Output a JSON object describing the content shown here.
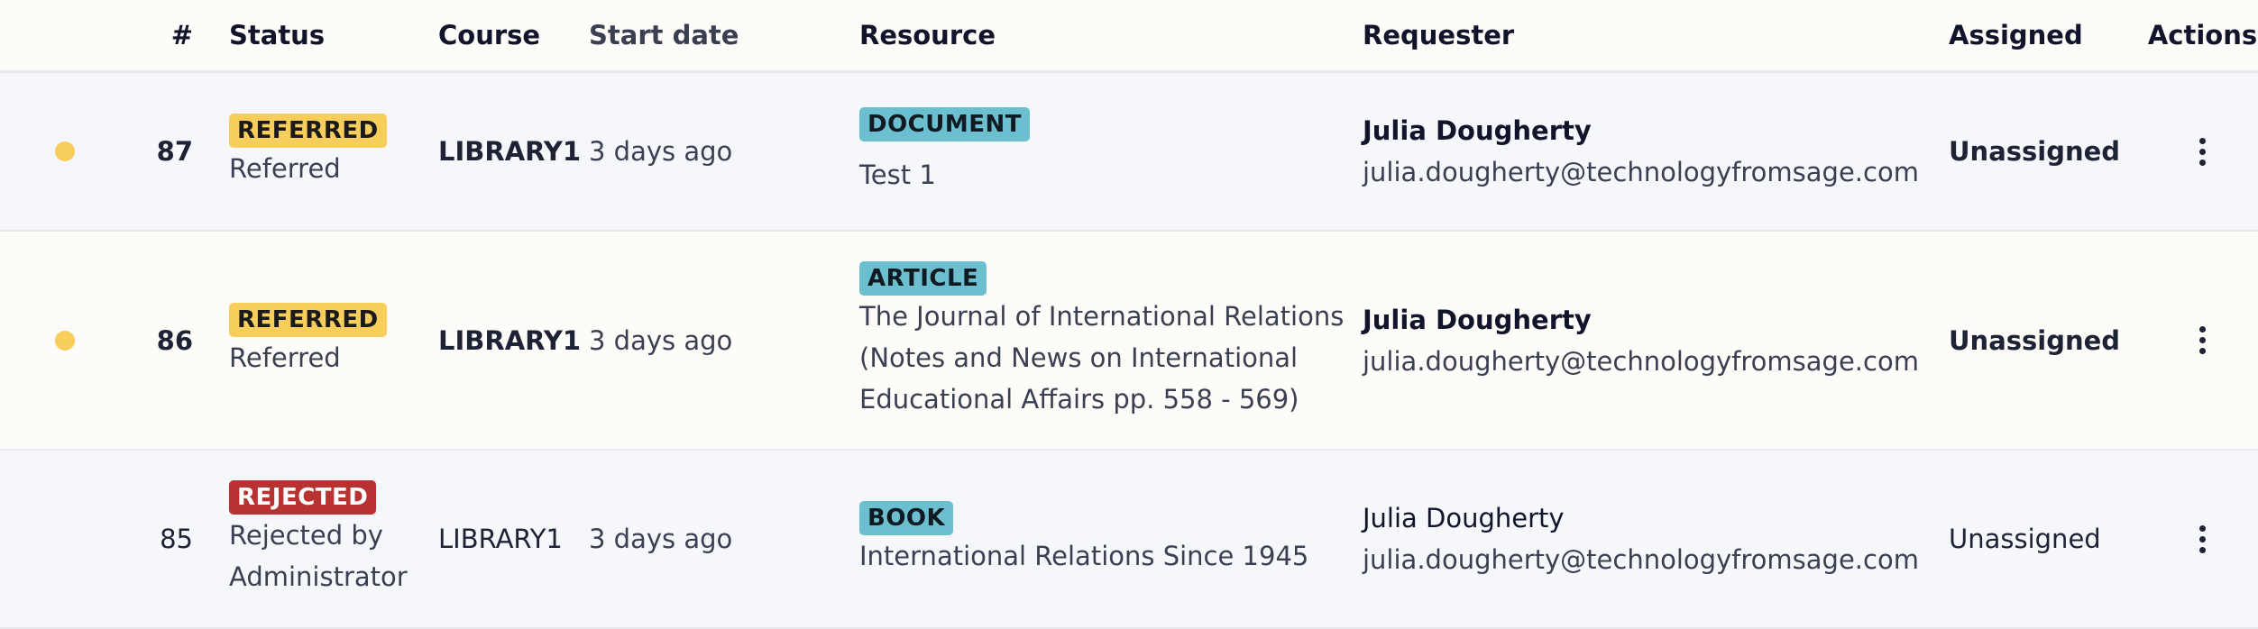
{
  "header": {
    "num": "#",
    "status": "Status",
    "course": "Course",
    "start_date": "Start date",
    "resource": "Resource",
    "requester": "Requester",
    "assigned": "Assigned",
    "actions": "Actions"
  },
  "rows": [
    {
      "unread": true,
      "num": "87",
      "status_badge": "REFERRED",
      "status_text": "Referred",
      "course": "LIBRARY1",
      "start_date": "3 days ago",
      "resource_type": "DOCUMENT",
      "resource_title": "Test 1",
      "requester_name": "Julia Dougherty",
      "requester_email": "julia.dougherty@technologyfromsage.com",
      "assigned": "Unassigned"
    },
    {
      "unread": true,
      "num": "86",
      "status_badge": "REFERRED",
      "status_text": "Referred",
      "course": "LIBRARY1",
      "start_date": "3 days ago",
      "resource_type": "ARTICLE",
      "resource_title_lines": [
        "The Journal of International Relations",
        "(Notes and News on International",
        "Educational Affairs pp. 558 - 569)"
      ],
      "requester_name": "Julia Dougherty",
      "requester_email": "julia.dougherty@technologyfromsage.com",
      "assigned": "Unassigned"
    },
    {
      "unread": false,
      "num": "85",
      "status_badge": "REJECTED",
      "status_text_lines": [
        "Rejected by",
        "Administrator"
      ],
      "course": "LIBRARY1",
      "start_date": "3 days ago",
      "resource_type": "BOOK",
      "resource_title": "International Relations Since 1945",
      "requester_name": "Julia Dougherty",
      "requester_email": "julia.dougherty@technologyfromsage.com",
      "assigned": "Unassigned"
    }
  ],
  "colors": {
    "referred": "#f7cd5b",
    "rejected": "#b83232",
    "resource_type": "#6bbfcf",
    "unread_dot": "#f7cd5b"
  },
  "icons": {
    "unread": "unread-dot-icon",
    "actions": "kebab-menu-icon"
  }
}
